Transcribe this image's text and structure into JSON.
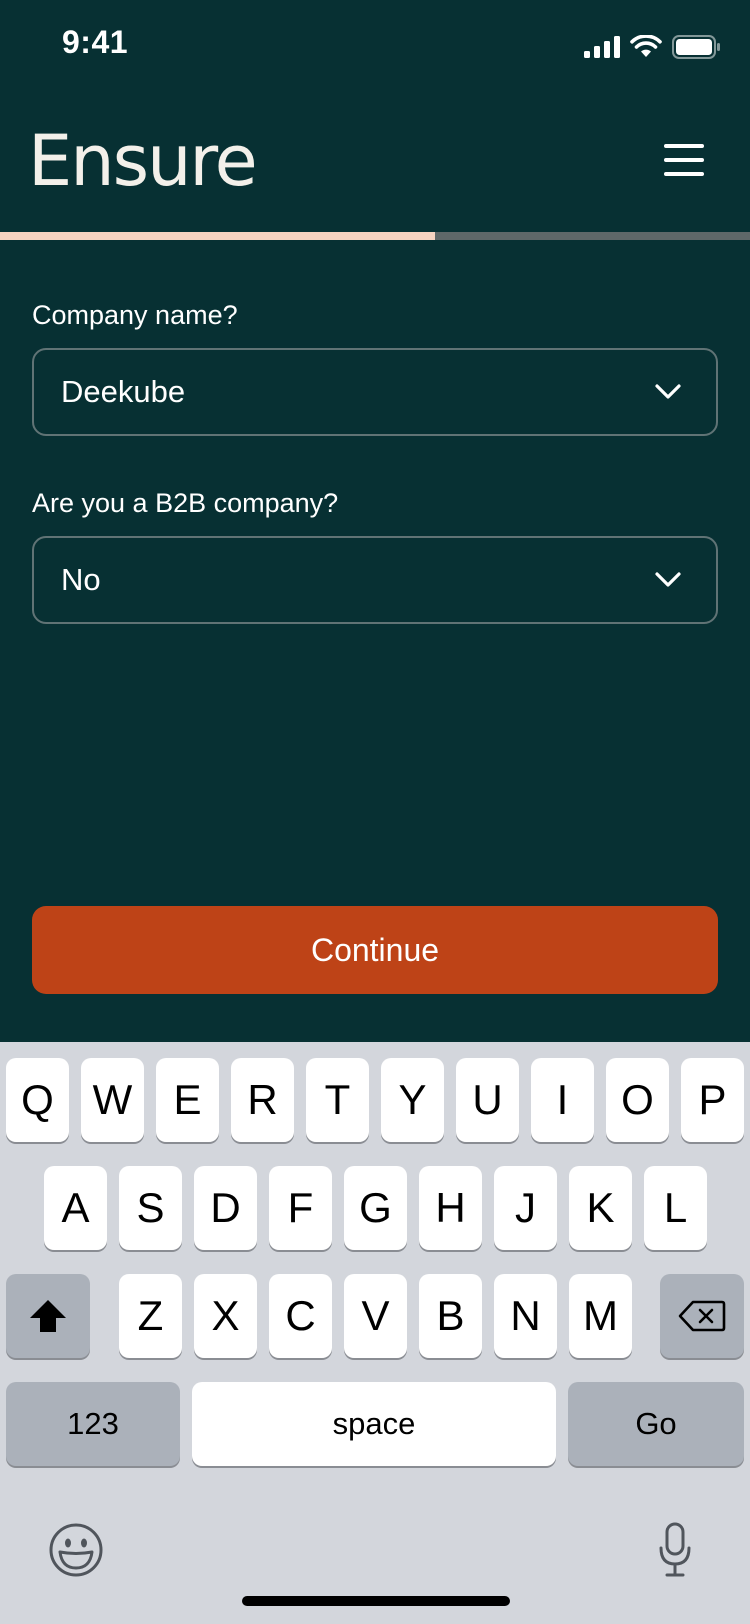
{
  "status_bar": {
    "time": "9:41"
  },
  "header": {
    "logo": "Ensure",
    "menu_icon": "hamburger-menu-icon"
  },
  "progress": {
    "fraction": 0.58,
    "fill_color": "#f6d3c1",
    "track_color": "#5f6869"
  },
  "form": {
    "company_name": {
      "label": "Company name?",
      "value": "Deekube"
    },
    "b2b": {
      "label": "Are you a B2B company?",
      "value": "No"
    }
  },
  "continue_button": {
    "label": "Continue",
    "color": "#be4317"
  },
  "keyboard": {
    "row1": [
      "Q",
      "W",
      "E",
      "R",
      "T",
      "Y",
      "U",
      "I",
      "O",
      "P"
    ],
    "row2": [
      "A",
      "S",
      "D",
      "F",
      "G",
      "H",
      "J",
      "K",
      "L"
    ],
    "row3": [
      "Z",
      "X",
      "C",
      "V",
      "B",
      "N",
      "M"
    ],
    "numbers_key": "123",
    "space_key": "space",
    "go_key": "Go"
  },
  "colors": {
    "background": "#073033",
    "keyboard_bg": "#d3d6dc"
  }
}
